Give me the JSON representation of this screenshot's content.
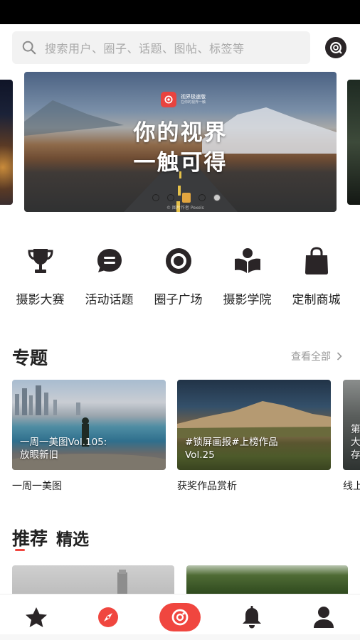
{
  "search": {
    "placeholder": "搜索用户、圈子、话题、图帖、标签等"
  },
  "icons": {
    "search": "search-icon",
    "header_logo": "app-logo-icon",
    "categories": [
      "trophy-icon",
      "chat-icon",
      "circle-icon",
      "academy-book-icon",
      "shopping-bag-icon"
    ],
    "nav": [
      "star-icon",
      "compass-icon",
      "camera-eye-icon",
      "bell-icon",
      "user-icon"
    ]
  },
  "banner": {
    "brand_name": "视界极速版",
    "brand_sub": "在你的视界一触",
    "title_line1": "你的视界",
    "title_line2": "一触可得",
    "credit": "© 图片作者 Pexels",
    "page_count": 4,
    "active_index": 2
  },
  "categories": [
    {
      "label": "摄影大赛"
    },
    {
      "label": "活动话题"
    },
    {
      "label": "圈子广场"
    },
    {
      "label": "摄影学院"
    },
    {
      "label": "定制商城"
    }
  ],
  "topics": {
    "title": "专题",
    "view_all": "查看全部",
    "items": [
      {
        "overlay_line1": "一周一美图Vol.105:",
        "overlay_line2": "放眼新旧",
        "caption": "一周一美图"
      },
      {
        "overlay_line1": "#锁屏画报#上榜作品",
        "overlay_line2": "Vol.25",
        "caption": "获奖作品赏析"
      },
      {
        "overlay_line1": "第",
        "overlay_line2": "大",
        "overlay_line3": "存",
        "caption": "线上"
      }
    ]
  },
  "recommend": {
    "tabs": [
      "推荐",
      "精选"
    ],
    "active_tab": 0
  },
  "colors": {
    "accent": "#f0463f",
    "icon_dark": "#2a2527",
    "banner_dot_active": "#e2a53f"
  }
}
